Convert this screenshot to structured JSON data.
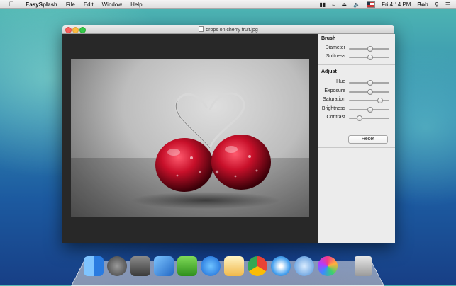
{
  "menubar": {
    "app_name": "EasySplash",
    "menus": [
      "File",
      "Edit",
      "Window",
      "Help"
    ],
    "clock": "Fri 4:14 PM",
    "user": "Bob"
  },
  "window": {
    "title": "drops on cherry fruit.jpg"
  },
  "panel": {
    "brush": {
      "title": "Brush",
      "sliders": [
        {
          "label": "Diameter",
          "value": 0.5
        },
        {
          "label": "Softness",
          "value": 0.5
        }
      ]
    },
    "adjust": {
      "title": "Adjust",
      "sliders": [
        {
          "label": "Hue",
          "value": 0.5
        },
        {
          "label": "Exposure",
          "value": 0.5
        },
        {
          "label": "Saturation",
          "value": 0.75
        },
        {
          "label": "Brightness",
          "value": 0.5
        },
        {
          "label": "Contrast",
          "value": 0.25
        }
      ]
    },
    "reset_label": "Reset"
  },
  "dock": {
    "apps": [
      "finder",
      "launchpad",
      "photo-booth",
      "xcode",
      "evernote",
      "app-store",
      "pages",
      "chrome",
      "safari",
      "mail",
      "game-center"
    ],
    "trash": "trash"
  }
}
